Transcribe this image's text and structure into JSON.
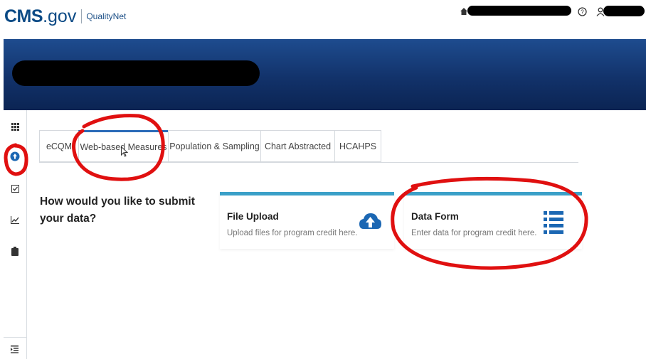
{
  "header": {
    "logo_cms": "CMS",
    "logo_gov": ".gov",
    "logo_qualitynet": "QualityNet",
    "help_icon": "help-circle-icon",
    "user_icon": "user-icon",
    "home_icon": "home-icon"
  },
  "sidebar": {
    "items": [
      {
        "icon": "grid-icon",
        "glyph": "▦"
      },
      {
        "icon": "upload-icon",
        "glyph": "⬆"
      },
      {
        "icon": "checkbox-icon",
        "glyph": "☑"
      },
      {
        "icon": "chart-icon",
        "glyph": "📈"
      },
      {
        "icon": "clipboard-icon",
        "glyph": "▮"
      }
    ],
    "bottom_icon": "menu-indent-icon",
    "bottom_glyph": "☰"
  },
  "tabs": [
    {
      "label": "eCQM",
      "active": false
    },
    {
      "label": "Web-based Measures",
      "active": true
    },
    {
      "label": "Population & Sampling",
      "active": false
    },
    {
      "label": "Chart Abstracted",
      "active": false
    },
    {
      "label": "HCAHPS",
      "active": false
    }
  ],
  "main": {
    "question": "How would you like to submit your data?"
  },
  "cards": [
    {
      "title": "File Upload",
      "subtitle": "Upload files for program credit here.",
      "icon": "cloud-upload-icon"
    },
    {
      "title": "Data Form",
      "subtitle": "Enter data for program credit here.",
      "icon": "list-icon"
    }
  ],
  "colors": {
    "brand": "#0b4a85",
    "banner": "#12326a",
    "card_accent": "#3aa0c8",
    "tab_accent": "#2b6bb8",
    "annotation": "#e01010"
  }
}
